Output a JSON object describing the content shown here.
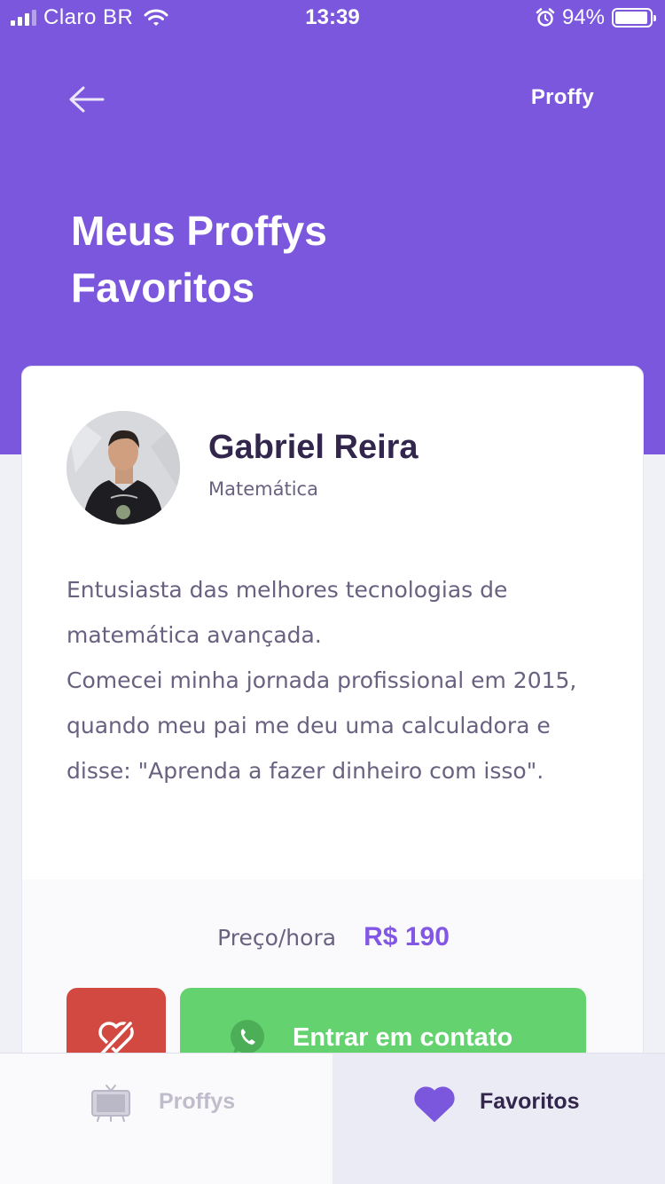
{
  "status_bar": {
    "carrier": "Claro BR",
    "time": "13:39",
    "battery": "94%",
    "battery_level": 0.94
  },
  "header": {
    "back_icon": "arrow-left-icon",
    "logo": "Proffy",
    "title_line1": "Meus Proffys",
    "title_line2": "Favoritos"
  },
  "teacher_card": {
    "name": "Gabriel Reira",
    "subject": "Matemática",
    "bio_line1": "Entusiasta das melhores tecnologias de matemática avançada.",
    "bio_line2": "Comecei minha jornada profissional em 2015, quando meu pai me deu uma calculadora e disse: \"Aprenda a fazer dinheiro com isso\".",
    "price_label": "Preço/hora",
    "price_value": "R$ 190",
    "unfavorite_icon": "heart-outline-broken-icon",
    "contact_icon": "whatsapp-icon",
    "contact_label": "Entrar em contato"
  },
  "tab_bar": {
    "tabs": [
      {
        "label": "Proffys",
        "icon": "tv-icon",
        "active": false
      },
      {
        "label": "Favoritos",
        "icon": "heart-icon",
        "active": true
      }
    ]
  },
  "colors": {
    "primary": "#7a57dd",
    "price": "#8257e5",
    "danger": "#d24941",
    "whatsapp": "#63d26f"
  }
}
